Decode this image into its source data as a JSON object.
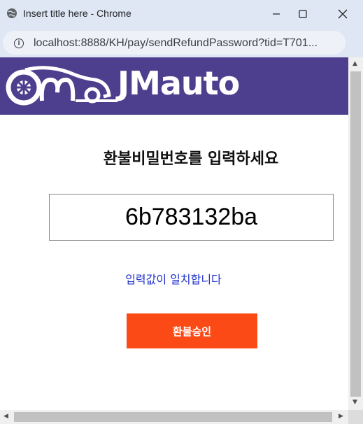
{
  "window": {
    "title": "Insert title here - Chrome",
    "url": "localhost:8888/KH/pay/sendRefundPassword?tid=T701..."
  },
  "header": {
    "brand": "JMauto",
    "brand_color": "#4e3f8e"
  },
  "main": {
    "heading": "환불비밀번호를 입력하세요",
    "password_value": "6b783132ba",
    "match_message": "입력값이 일치합니다",
    "match_color": "#2233cc",
    "submit_label": "환불승인",
    "submit_color": "#fc4a16"
  },
  "icons": {
    "window_globe": "globe-icon",
    "address_info": "info-icon",
    "minimize": "minimize-icon",
    "maximize": "maximize-icon",
    "close": "close-icon"
  }
}
